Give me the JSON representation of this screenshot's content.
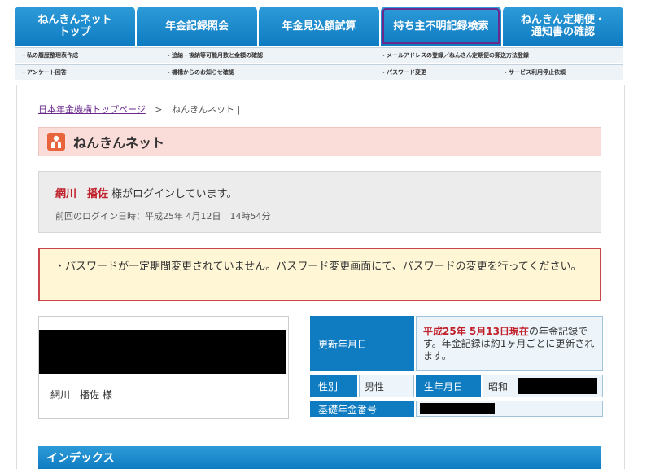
{
  "top_tabs": [
    {
      "label": "ねんきんネット\nトップ"
    },
    {
      "label": "年金記録照会"
    },
    {
      "label": "年金見込額試算"
    },
    {
      "label": "持ち主不明記録検索"
    },
    {
      "label": "ねんきん定期便・\n通知書の確認"
    }
  ],
  "subnav_row1": [
    "・私の履歴整理表作成",
    "・追納・後納等可能月数と金額の確認",
    "・メールアドレスの登録／ねんきん定期便の郵送方法登録"
  ],
  "subnav_row2": [
    "・アンケート回答",
    "・機構からのお知らせ確認",
    "・パスワード変更",
    "・サービス利用停止依頼"
  ],
  "breadcrumb": {
    "home": "日本年金機構トップページ",
    "separator": ">",
    "current": "ねんきんネット |"
  },
  "page_title": "ねんきんネット",
  "login": {
    "name": "網川　播佐",
    "suffix": "様がログインしています。",
    "last_login": "前回のログイン日時：平成25年 4月12日　14時54分"
  },
  "warning": "・パスワードが一定期間変更されていません。パスワード変更画面にて、パスワードの変更を行ってください。",
  "name_panel": {
    "name": "網川　播佐 様"
  },
  "info": {
    "updated_label": "更新年月日",
    "updated_date": "平成25年 5月13日現在",
    "updated_rest": "の年金記録です。年金記録は約1ヶ月ごとに更新されます。",
    "gender_label": "性別",
    "gender_value": "男性",
    "birth_label": "生年月日",
    "birth_value": "昭和",
    "pension_number_label": "基礎年金番号"
  },
  "index_title": "インデックス",
  "colors": {
    "tab_blue": "#0f7cc2",
    "title_bg": "#fadcd8",
    "warning_border": "#c8454a",
    "warning_bg": "#fff6d6",
    "name_red": "#c0202a"
  }
}
